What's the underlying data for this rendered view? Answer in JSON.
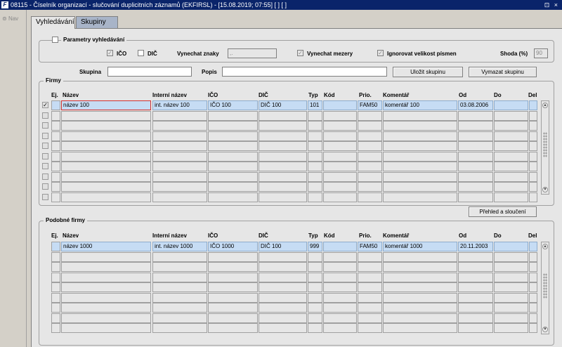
{
  "window": {
    "title": "08115 - Číselník organizací - slučování duplicitních záznamů (EKFIRSL) - [15.08.2019; 07:55] [ ] [ ]",
    "icon": "forms-app-icon",
    "buttons": "⊡ ×"
  },
  "sidebar": {
    "nav_label": "Nav"
  },
  "tabs": [
    {
      "label": "Vyhledávání",
      "active": true
    },
    {
      "label": "Skupiny",
      "active": false
    }
  ],
  "search": {
    "group_title": "Parametry vyhledávání",
    "ico_label": "IČO",
    "dic_label": "DIČ",
    "vynechat_znaky_label": "Vynechat znaky",
    "vynechat_znaky_value": ",.",
    "vynechat_mezery_label": "Vynechat mezery",
    "ignorovat_label": "Ignorovat velikost písmen",
    "shoda_label": "Shoda (%)",
    "shoda_value": "90"
  },
  "group_row": {
    "skupina_label": "Skupina",
    "skupina_value": "",
    "popis_label": "Popis",
    "popis_value": "",
    "save_button": "Uložit skupinu",
    "delete_button": "Vymazat skupinu"
  },
  "firmy": {
    "title": "Firmy",
    "headers": [
      "Ej.",
      "Název",
      "Interní název",
      "IČO",
      "DIČ",
      "Typ",
      "Kód",
      "Prio.",
      "Komentář",
      "Od",
      "Do",
      "Del"
    ],
    "row": {
      "nazev": "název 100",
      "interni": "int. název 100",
      "ico": "IČO 100",
      "dic": "DIČ 100",
      "typ": "101",
      "kod": "",
      "prio": "FAM50",
      "komentar": "komentář 100",
      "od": "03.08.2006",
      "do": "",
      "del": ""
    },
    "first_checked": "✓"
  },
  "prehled_button": "Přehled a sloučení",
  "podobne": {
    "title": "Podobné firmy",
    "headers": [
      "Ej.",
      "Název",
      "Interní název",
      "IČO",
      "DIČ",
      "Typ",
      "Kód",
      "Prio.",
      "Komentář",
      "Od",
      "Do",
      "Del"
    ],
    "row": {
      "nazev": "název 1000",
      "interni": "int. název 1000",
      "ico": "IČO 1000",
      "dic": "DIČ 100",
      "typ": "999",
      "kod": "",
      "prio": "FAM50",
      "komentar": "komentář 1000",
      "od": "20.11.2003",
      "do": "",
      "del": ""
    }
  },
  "icons": {
    "scroll_up": "▲",
    "scroll_down": "▼"
  },
  "colors": {
    "titlebar": "#0a246a",
    "selected_row": "#c6dcf4",
    "focus_border": "#d03030"
  }
}
